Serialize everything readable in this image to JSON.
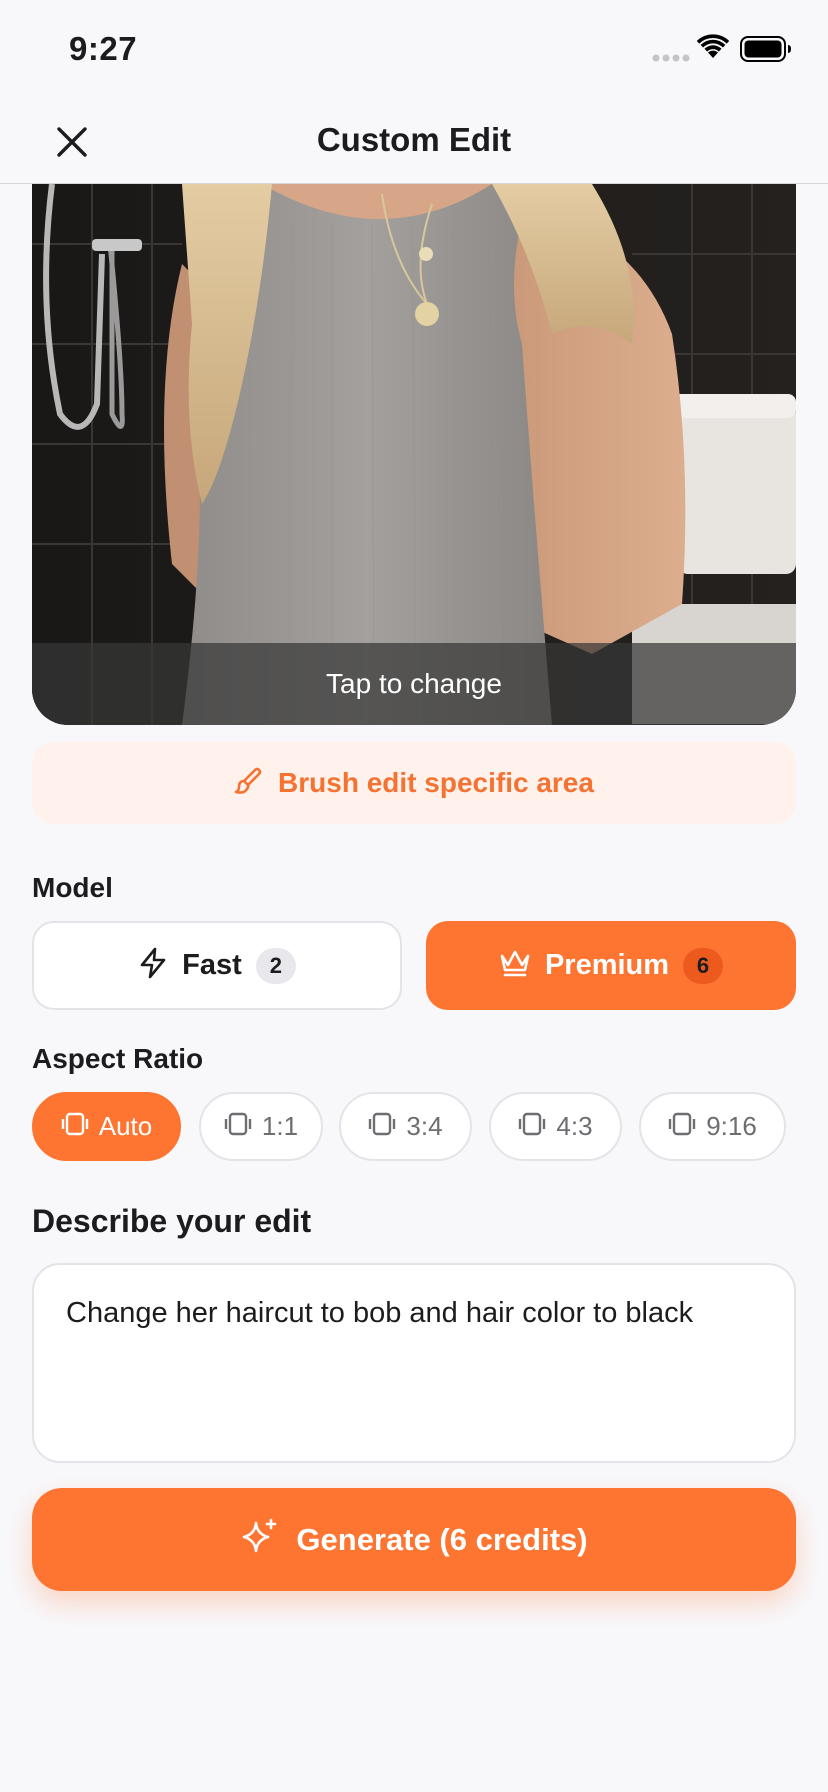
{
  "status_bar": {
    "time": "9:27"
  },
  "nav": {
    "title": "Custom Edit",
    "close_icon": "close-icon"
  },
  "photo": {
    "overlay_label": "Tap to change"
  },
  "brush": {
    "label": "Brush edit specific area",
    "icon": "brush-icon"
  },
  "model": {
    "section_label": "Model",
    "options": [
      {
        "name": "Fast",
        "credits": "2",
        "icon": "lightning-icon",
        "selected": false
      },
      {
        "name": "Premium",
        "credits": "6",
        "icon": "crown-icon",
        "selected": true
      }
    ]
  },
  "aspect": {
    "section_label": "Aspect Ratio",
    "options": [
      {
        "label": "Auto",
        "selected": true
      },
      {
        "label": "1:1",
        "selected": false
      },
      {
        "label": "3:4",
        "selected": false
      },
      {
        "label": "4:3",
        "selected": false
      },
      {
        "label": "9:16",
        "selected": false
      }
    ]
  },
  "describe": {
    "section_label": "Describe your edit",
    "value": "Change her haircut to bob and hair color to black"
  },
  "generate": {
    "label": "Generate (6 credits)",
    "icon": "sparkles-icon"
  },
  "colors": {
    "accent": "#fe7532",
    "accent_light": "#fff1ec",
    "background": "#f8f8fb"
  }
}
